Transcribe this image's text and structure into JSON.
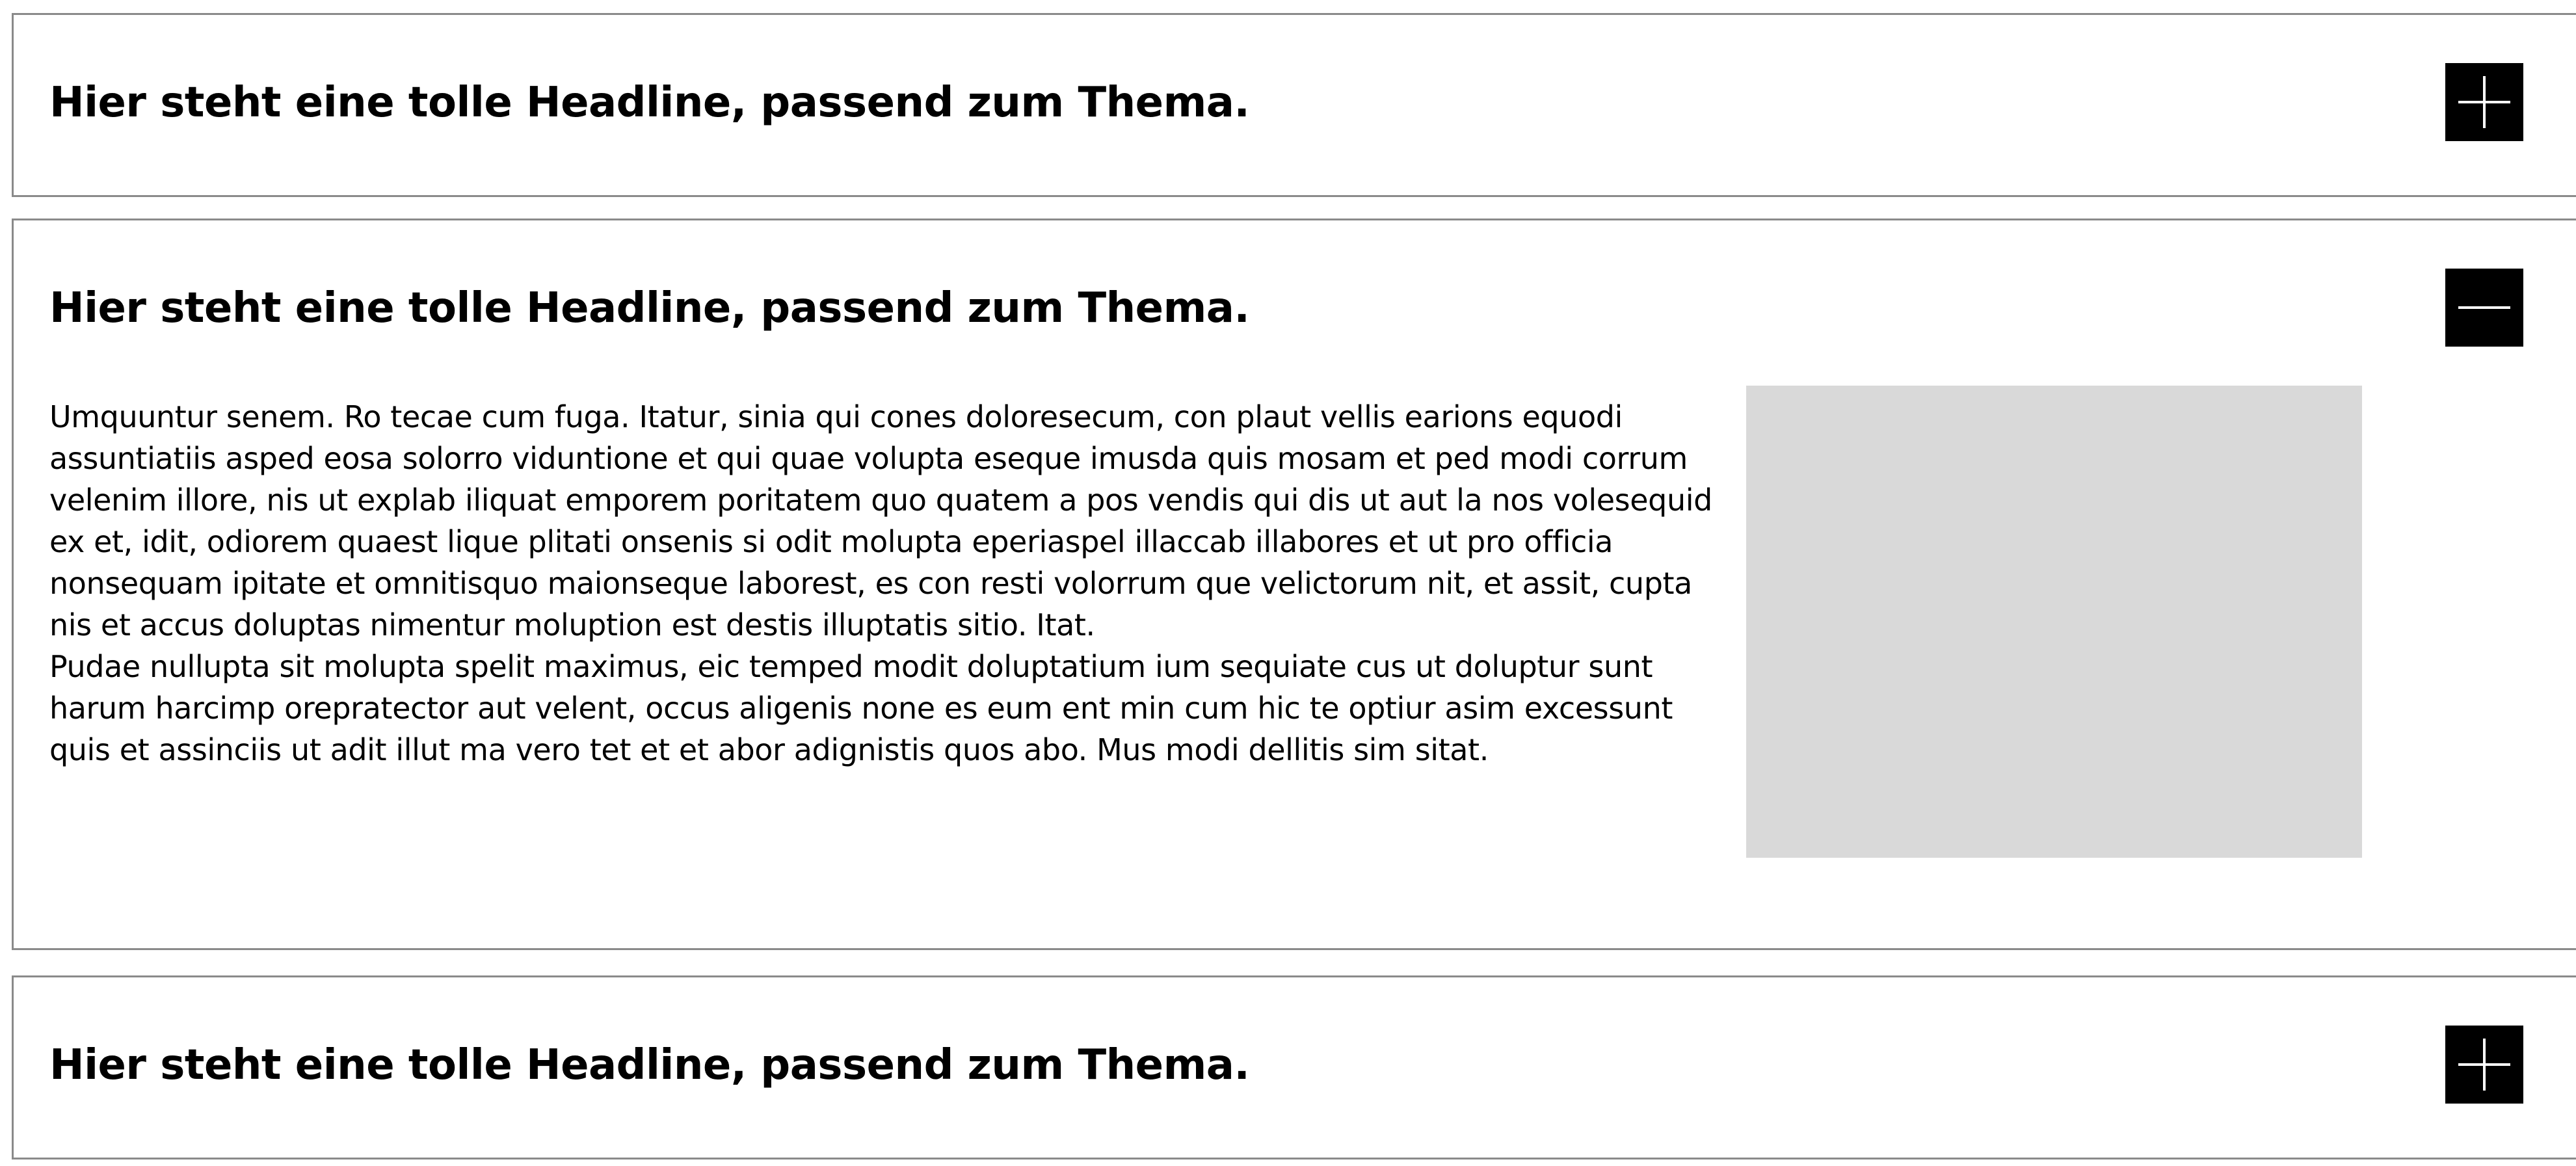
{
  "accordion": {
    "items": [
      {
        "title": "Hier steht eine tolle Headline, passend zum Thema.",
        "expanded": false,
        "toggle_icon": "plus-icon"
      },
      {
        "title": "Hier steht eine tolle Headline, passend zum Thema.",
        "expanded": true,
        "toggle_icon": "minus-icon",
        "paragraphs": [
          "Umquuntur senem. Ro tecae cum fuga. Itatur, sinia qui cones doloresecum, con plaut vellis earions equodi assuntiatiis asped eosa solorro viduntione et qui quae volupta eseque imusda quis mosam et ped modi corrum velenim illore, nis ut explab iliquat emporem poritatem quo quatem a pos vendis qui dis ut aut la nos volesequid ex et, idit, odiorem quaest lique plitati onsenis si odit molupta eperiaspel illaccab illabores et ut pro officia nonsequam ipitate et omnitisquo maionseque laborest, es con resti volorrum que velictorum nit, et assit, cupta nis et accus doluptas nimentur moluption est destis illuptatis sitio. Itat.",
          "Pudae nullupta sit molupta spelit maximus, eic temped modit doluptatium ium sequiate cus ut doluptur sunt harum harcimp orepratector aut velent, occus aligenis none es eum ent min cum hic te optiur asim excessunt quis et assinciis ut adit illut ma vero tet et et abor adignistis quos abo. Mus modi dellitis sim sitat."
        ],
        "image_placeholder_color": "#d9d9d9"
      },
      {
        "title": "Hier steht eine tolle Headline, passend zum Thema.",
        "expanded": false,
        "toggle_icon": "plus-icon"
      }
    ]
  },
  "colors": {
    "border": "#8a8a8a",
    "toggle_background": "#000000",
    "toggle_icon": "#ffffff",
    "placeholder": "#d9d9d9"
  }
}
